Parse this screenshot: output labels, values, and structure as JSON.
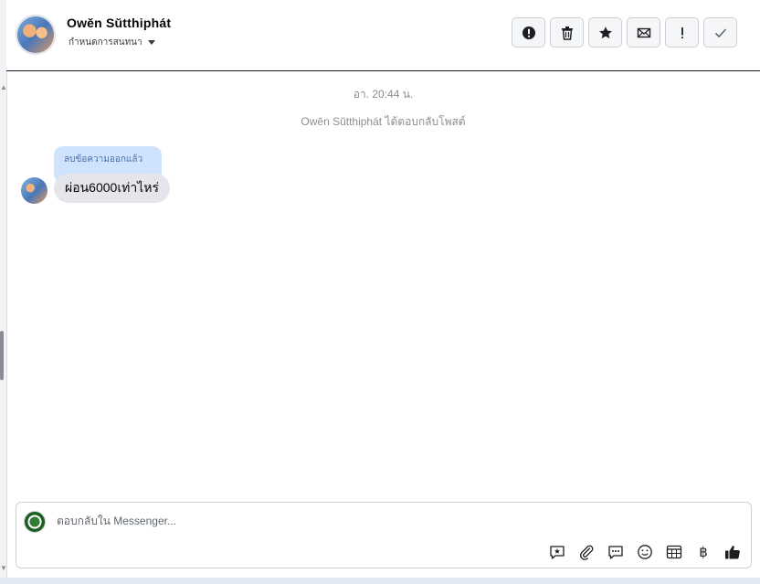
{
  "contact": {
    "name": "Owĕn Sŭtthiphát",
    "subtitle": "กำหนดการสนทนา"
  },
  "toolbar": {
    "buttons": [
      {
        "icon": "alert-circle-icon",
        "label": "report"
      },
      {
        "icon": "trash-icon",
        "label": "delete"
      },
      {
        "icon": "star-icon",
        "label": "star"
      },
      {
        "icon": "envelope-icon",
        "label": "mark unread"
      },
      {
        "icon": "exclamation-icon",
        "label": "spam"
      },
      {
        "icon": "checkmark-icon",
        "label": "done"
      }
    ]
  },
  "thread": {
    "timestamp": "อา. 20:44 น.",
    "system_message": "Owĕn Sŭtthiphát ได้ตอบกลับโพสต์",
    "reply_chip": "ลบข้อความออกแล้ว",
    "message": "ผ่อน6000เท่าไหร่"
  },
  "composer": {
    "placeholder": "ตอบกลับใน Messenger...",
    "tools": [
      "saved-reply-icon",
      "attachment-icon",
      "chat-bubble-icon",
      "emoji-icon",
      "appointment-icon",
      "baht-icon",
      "thumbs-up-icon"
    ],
    "baht_symbol": "฿"
  }
}
